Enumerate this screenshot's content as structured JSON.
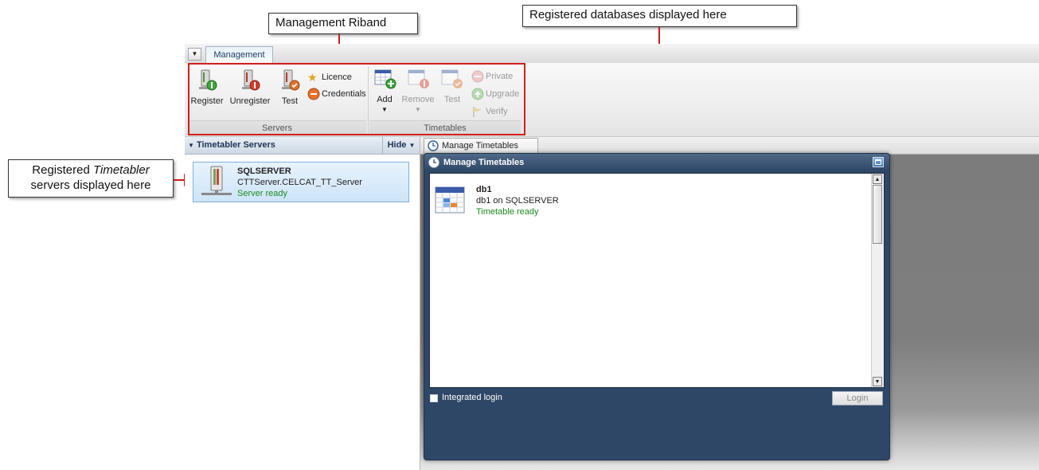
{
  "callouts": {
    "ribbon": "Management Riband",
    "databases": "Registered databases displayed here",
    "servers_part1": "Registered ",
    "servers_italic": "Timetabler",
    "servers_part2": "servers displayed here"
  },
  "app": {
    "tab": "Management",
    "ribbon": {
      "servers_group": "Servers",
      "timetables_group": "Timetables",
      "register": "Register",
      "unregister": "Unregister",
      "test": "Test",
      "licence": "Licence",
      "credentials": "Credentials",
      "add": "Add",
      "remove": "Remove",
      "test_tt": "Test",
      "private": "Private",
      "upgrade": "Upgrade",
      "verify": "Verify"
    },
    "left_panel": {
      "title": "Timetabler Servers",
      "hide": "Hide",
      "server": {
        "name": "SQLSERVER",
        "instance": "CTTServer.CELCAT_TT_Server",
        "status": "Server ready"
      }
    },
    "right_panel": {
      "tab": "Manage Timetables",
      "window_title": "Manage Timetables",
      "timetable": {
        "name": "db1",
        "location": "db1 on SQLSERVER",
        "status": "Timetable ready"
      },
      "integrated_login": "Integrated login",
      "login": "Login"
    }
  },
  "colors": {
    "highlight_red": "#d21f1f",
    "status_green": "#1e8a1e",
    "window_navy": "#2f4766"
  }
}
